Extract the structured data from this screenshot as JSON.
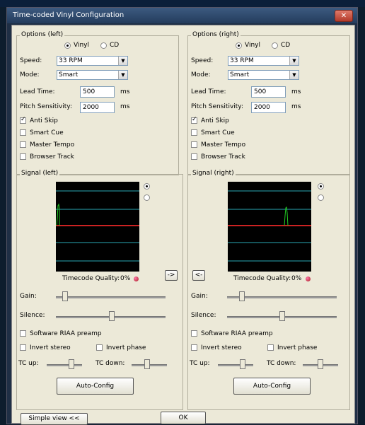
{
  "dialog": {
    "title": "Time-coded Vinyl Configuration",
    "close_symbol": "✕"
  },
  "options_left": {
    "label": "Options (left)",
    "vinyl_label": "Vinyl",
    "cd_label": "CD",
    "speed_label": "Speed:",
    "speed_value": "33 RPM",
    "mode_label": "Mode:",
    "mode_value": "Smart",
    "lead_time_label": "Lead Time:",
    "lead_time_value": "500",
    "lead_time_unit": "ms",
    "pitch_label": "Pitch Sensitivity:",
    "pitch_value": "2000",
    "pitch_unit": "ms",
    "anti_skip": "Anti Skip",
    "smart_cue": "Smart Cue",
    "master_tempo": "Master Tempo",
    "browser_track": "Browser Track"
  },
  "options_right": {
    "label": "Options (right)",
    "vinyl_label": "Vinyl",
    "cd_label": "CD",
    "speed_label": "Speed:",
    "speed_value": "33 RPM",
    "mode_label": "Mode:",
    "mode_value": "Smart",
    "lead_time_label": "Lead Time:",
    "lead_time_value": "500",
    "lead_time_unit": "ms",
    "pitch_label": "Pitch Sensitivity:",
    "pitch_value": "2000",
    "pitch_unit": "ms",
    "anti_skip": "Anti Skip",
    "smart_cue": "Smart Cue",
    "master_tempo": "Master Tempo",
    "browser_track": "Browser Track"
  },
  "signal_left": {
    "label": "Signal (left)",
    "quality_label": "Timecode Quality:",
    "quality_value": "0%",
    "copy_button": "->",
    "gain_label": "Gain:",
    "silence_label": "Silence:",
    "riaa": "Software RIAA preamp",
    "invert_stereo": "Invert stereo",
    "invert_phase": "Invert phase",
    "tc_up": "TC up:",
    "tc_down": "TC down:",
    "auto_config": "Auto-Config"
  },
  "signal_right": {
    "label": "Signal (right)",
    "quality_label": "Timecode Quality:",
    "quality_value": "0%",
    "copy_button": "<-",
    "gain_label": "Gain:",
    "silence_label": "Silence:",
    "riaa": "Software RIAA preamp",
    "invert_stereo": "Invert stereo",
    "invert_phase": "Invert phase",
    "tc_up": "TC up:",
    "tc_down": "TC down:",
    "auto_config": "Auto-Config"
  },
  "footer": {
    "simple_view": "Simple view <<",
    "ok": "OK"
  },
  "colors": {
    "scope_cyan": "#2aa7b5",
    "scope_red": "#c22",
    "scope_green": "#2c2"
  }
}
